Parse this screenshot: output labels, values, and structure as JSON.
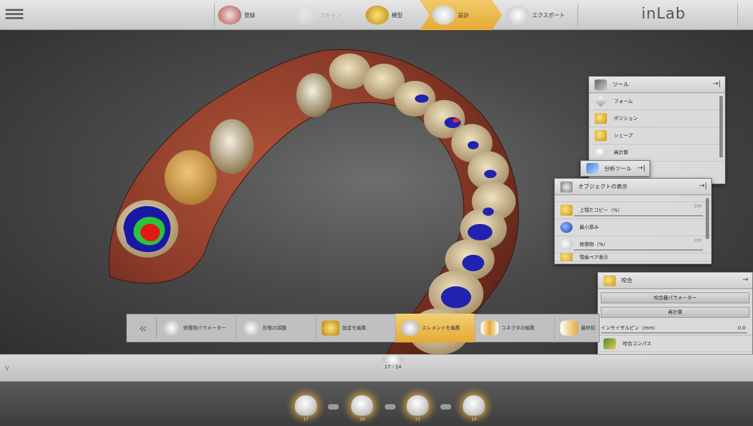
{
  "app": {
    "logo": "inLab"
  },
  "steps": [
    {
      "label": "登録",
      "state": "normal"
    },
    {
      "label": "スキャン",
      "state": "dim"
    },
    {
      "label": "模型",
      "state": "normal"
    },
    {
      "label": "設計",
      "state": "active"
    },
    {
      "label": "エクスポート",
      "state": "normal"
    }
  ],
  "tools_panel": {
    "title": "ツール",
    "items": [
      "フォーム",
      "ポジション",
      "シェープ",
      "再計算"
    ]
  },
  "analysis_tab": {
    "label": "分析ツール"
  },
  "object_panel": {
    "title": "オブジェクトの表示",
    "items": [
      {
        "label": "上顎たコピー（%）",
        "value": "100"
      },
      {
        "label": "最小厚み",
        "value": ""
      },
      {
        "label": "修復物（%）",
        "value": "100"
      },
      {
        "label": "顎歯ペア表示",
        "value": ""
      }
    ]
  },
  "occlusion_panel": {
    "title": "咬合",
    "param_button": "咬合器パラメーター",
    "recalc_button": "再計算",
    "incisal_label": "インサイザルピン（mm）",
    "incisal_value": "0.0",
    "compass_label": "咬合コンパス"
  },
  "toolbar": {
    "items": [
      {
        "label": "修復物パラメーター",
        "active": false
      },
      {
        "label": "形態の調整",
        "active": false
      },
      {
        "label": "設定を編集",
        "active": false
      },
      {
        "label": "エレメントを編集",
        "active": true
      },
      {
        "label": "コネクタの編集",
        "active": false
      },
      {
        "label": "最終処理",
        "active": false
      }
    ]
  },
  "selection": {
    "label": "17 - 14"
  },
  "tooth_slots": [
    "17",
    "16",
    "15",
    "14"
  ],
  "colors": {
    "accent": "#e6a935",
    "deviation_blue": "#1a1aa8",
    "deviation_red": "#e01010"
  }
}
